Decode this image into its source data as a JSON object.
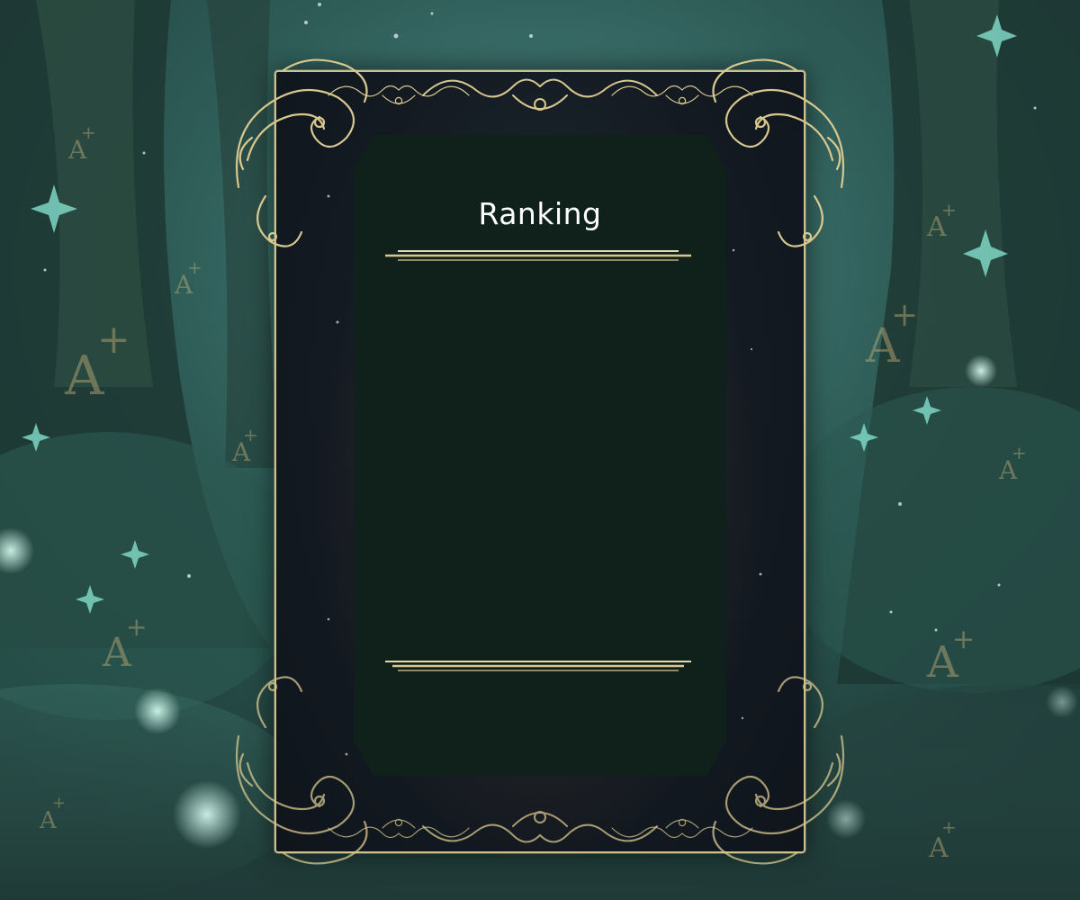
{
  "panel": {
    "title": "Ranking",
    "entries": []
  },
  "colors": {
    "gold": "#d8c88f",
    "panel_bg": "#10201b",
    "forest_dark": "#1b3a36",
    "forest_glow": "#7fd6c4"
  },
  "icons": [
    "a-plus-icon",
    "sparkle-icon",
    "ornate-flourish-icon"
  ]
}
